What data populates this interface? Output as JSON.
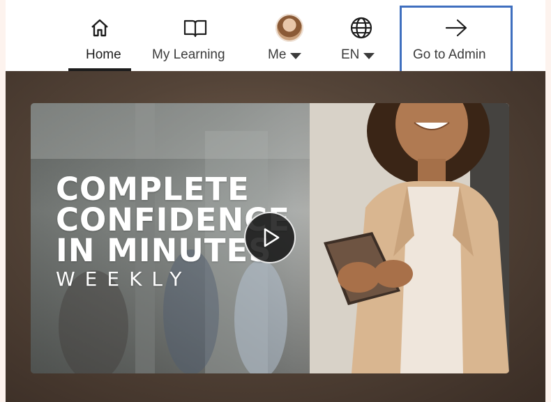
{
  "nav": {
    "items": [
      {
        "label": "Home",
        "icon": "home-icon",
        "active": true
      },
      {
        "label": "My Learning",
        "icon": "book-icon",
        "active": false
      },
      {
        "label": "Me",
        "icon": "avatar",
        "active": false,
        "dropdown": true
      },
      {
        "label": "EN",
        "icon": "globe-icon",
        "active": false,
        "dropdown": true
      },
      {
        "label": "Go to Admin",
        "icon": "arrow-right-icon",
        "active": false
      }
    ]
  },
  "hero": {
    "headline_lines": [
      "COMPLETE",
      "CONFIDENCE",
      "IN MINUTES"
    ],
    "subheadline": "WEEKLY",
    "play_icon": "play-icon"
  },
  "colors": {
    "highlight": "#3f6fbf",
    "page_bg": "#fdf3ee",
    "nav_bg": "#ffffff",
    "text": "#3b3b3b"
  }
}
